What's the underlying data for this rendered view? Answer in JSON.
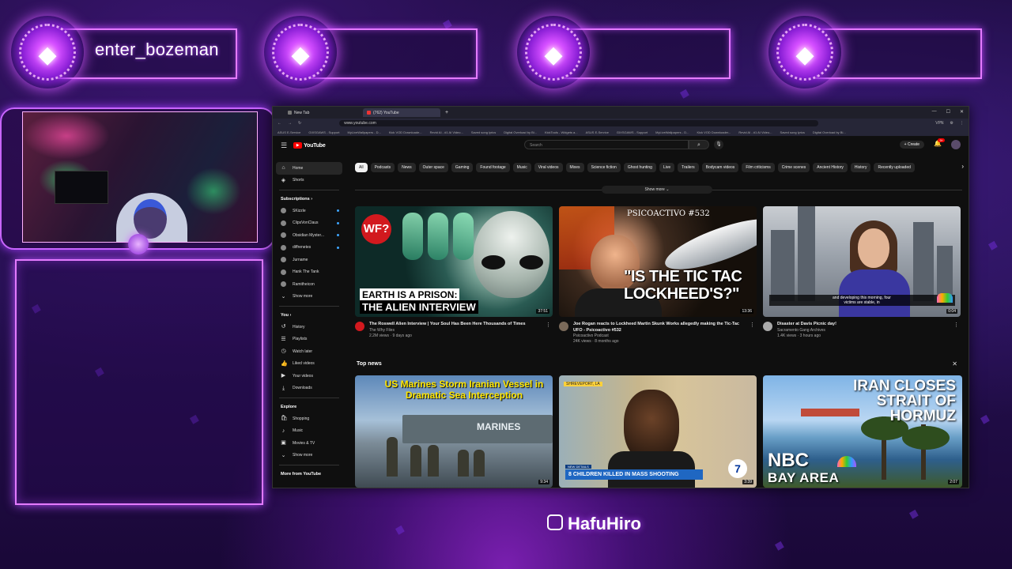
{
  "overlay": {
    "badges": [
      {
        "name": "enter_bozeman"
      },
      {
        "name": ""
      },
      {
        "name": ""
      },
      {
        "name": ""
      }
    ],
    "handle": "HafuHiro",
    "colors": {
      "neon": "#e47bff",
      "bg": "#1a0b3a"
    }
  },
  "browser": {
    "tabs": [
      {
        "label": "New Tab"
      },
      {
        "label": "(762) YouTube"
      }
    ],
    "url": "www.youtube.com",
    "bookmarks": [
      "ASUS E-Service",
      "GIXSGAWS - Support",
      "MyLiveWallpapers - D...",
      "Kick VOD Downloade...",
      "Revid AI - #1 AI Video...",
      "Saved song lyrics",
      "Digital Overload by Bi...",
      "KickTools - Widgets a...",
      "ASUS E-Service",
      "GIXSGAWS - Support",
      "MyLiveWallpapers - D...",
      "Kick VOD Downloader...",
      "Revid AI - #1 AI Video...",
      "Saved song lyrics",
      "Digital Overload by Bi..."
    ],
    "vpn_label": "VPN"
  },
  "youtube": {
    "logo": "YouTube",
    "search_placeholder": "Search",
    "create_label": "Create",
    "notif_count": "9+",
    "sidebar": {
      "main": [
        {
          "label": "Home",
          "icon": "home-icon"
        },
        {
          "label": "Shorts",
          "icon": "shorts-icon"
        }
      ],
      "subscriptions_title": "Subscriptions",
      "subscriptions": [
        "SKizzle",
        "ClipsVonClaus",
        "Obsidian Myster...",
        "diffrenetes",
        "Jurname",
        "Hank The Tank",
        "Ramitheicon"
      ],
      "subs_show_more": "Show more",
      "you_title": "You",
      "you_items": [
        {
          "label": "History",
          "icon": "history-icon"
        },
        {
          "label": "Playlists",
          "icon": "playlists-icon"
        },
        {
          "label": "Watch later",
          "icon": "watch-later-icon"
        },
        {
          "label": "Liked videos",
          "icon": "like-icon"
        },
        {
          "label": "Your videos",
          "icon": "your-videos-icon"
        },
        {
          "label": "Downloads",
          "icon": "download-icon"
        }
      ],
      "explore_title": "Explore",
      "explore_items": [
        {
          "label": "Shopping",
          "icon": "shopping-icon"
        },
        {
          "label": "Music",
          "icon": "music-icon"
        },
        {
          "label": "Movies & TV",
          "icon": "movies-icon"
        }
      ],
      "explore_show_more": "Show more",
      "more_title": "More from YouTube"
    },
    "chips": [
      "All",
      "Podcasts",
      "News",
      "Outer space",
      "Gaming",
      "Found footage",
      "Music",
      "Viral videos",
      "Mixes",
      "Science fiction",
      "Ghost hunting",
      "Live",
      "Trailers",
      "Bodycam videos",
      "Film criticisms",
      "Crime scenes",
      "Ancient History",
      "History",
      "Recently uploaded"
    ],
    "show_more": "Show more",
    "videos": [
      {
        "title": "The Roswell Alien Interview | Your Soul Has Been Here Thousands of Times",
        "channel": "The Why Files",
        "stats": "2.2M views · 9 days ago",
        "duration": "37:51",
        "thumb_top": "EARTH IS A PRISON:",
        "thumb_bottom": "THE ALIEN INTERVIEW",
        "badge": "WF?"
      },
      {
        "title": "Joe Rogan reacts to Lockheed Martin Skunk Works allegedly making the Tic-Tac UFO - Psicoactivo #532",
        "channel": "Psicoactivo Podcast",
        "stats": "24K views · 8 months ago",
        "duration": "13:36",
        "thumb_tag": "PSICOACTIVO #532",
        "thumb_quote": "\"IS THE TIC TAC LOCKHEED'S?\""
      },
      {
        "title": "Disaster at Davis Picnic day!",
        "channel": "Sacramento Gang Archives",
        "stats": "1.4K views · 3 hours ago",
        "duration": "0:04",
        "cc": "and developing this morning, four victims are stable, in"
      }
    ],
    "top_news_title": "Top news",
    "news": [
      {
        "headline": "US Marines Storm Iranian Vessel in Dramatic Sea Interception",
        "duration": "9:34",
        "ship_text": "MARINES"
      },
      {
        "headline": "8 CHILDREN KILLED IN MASS SHOOTING",
        "sub": "NEW DETAILS",
        "sticker": "SHREVEPORT, LA",
        "duration": "3:39",
        "logo": "7"
      },
      {
        "headline": "IRAN CLOSES STRAIT OF HORMUZ",
        "network": "NBC",
        "region": "BAY AREA",
        "duration": "2:07"
      }
    ]
  }
}
